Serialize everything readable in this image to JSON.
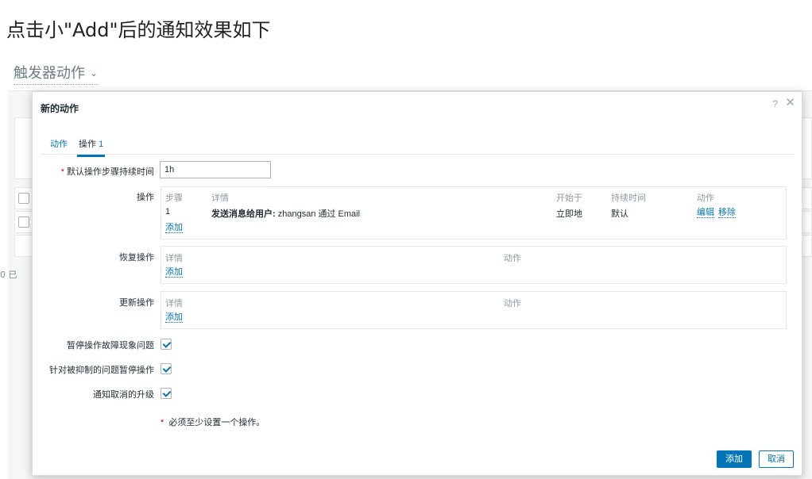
{
  "article": {
    "title": "点击小\"Add\"后的通知效果如下",
    "section_dropdown": "触发器动作",
    "section_chevron_icon": "chevron-down-icon"
  },
  "background": {
    "footer_text": "0 已"
  },
  "modal": {
    "title": "新的动作",
    "help_label": "?",
    "close_icon": "close-icon",
    "tabs": [
      {
        "label": "动作",
        "active": false
      },
      {
        "label": "操作",
        "count": "1",
        "active": true
      }
    ],
    "duration": {
      "label": "默认操作步骤持续时间",
      "value": "1h",
      "required_mark": "*"
    },
    "operations": {
      "label": "操作",
      "headers": {
        "steps": "步骤",
        "details": "详情",
        "start": "开始于",
        "duration": "持续时间",
        "action": "动作"
      },
      "rows": [
        {
          "step": "1",
          "detail_bold": "发送消息给用户:",
          "detail_rest": " zhangsan 通过 Email",
          "start": "立即地",
          "duration": "默认",
          "edit": "编辑",
          "remove": "移除"
        }
      ],
      "add_link": "添加"
    },
    "recovery": {
      "label": "恢复操作",
      "headers": {
        "details": "详情",
        "action": "动作"
      },
      "add_link": "添加"
    },
    "update": {
      "label": "更新操作",
      "headers": {
        "details": "详情",
        "action": "动作"
      },
      "add_link": "添加"
    },
    "checkboxes": [
      {
        "label": "暂停操作故障现象问题",
        "checked": true
      },
      {
        "label": "针对被抑制的问题暂停操作",
        "checked": true
      },
      {
        "label": "通知取消的升级",
        "checked": true
      }
    ],
    "note": {
      "required_mark": "*",
      "text": " 必须至少设置一个操作。"
    },
    "buttons": {
      "add": "添加",
      "cancel": "取消"
    },
    "colors": {
      "accent": "#0275b8",
      "required": "#d40000"
    }
  }
}
